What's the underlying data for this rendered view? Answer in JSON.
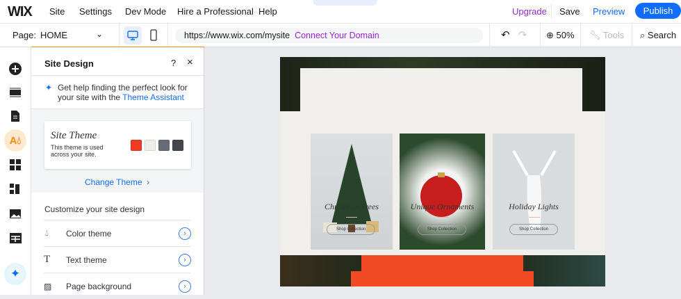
{
  "topbar": {
    "logo": "WIX",
    "menu": [
      "Site",
      "Settings",
      "Dev Mode",
      "Hire a Professional",
      "Help"
    ],
    "upgrade": "Upgrade",
    "save": "Save",
    "preview": "Preview",
    "publish": "Publish"
  },
  "toolbar": {
    "page_label": "Page:",
    "page_value": "HOME",
    "url": "https://www.wix.com/mysite",
    "connect_domain": "Connect Your Domain",
    "zoom": "50%",
    "tools": "Tools",
    "search": "Search"
  },
  "panel": {
    "title": "Site Design",
    "help": "?",
    "assistant_text": "Get help finding the perfect look for your site with the ",
    "assistant_link": "Theme Assistant",
    "theme_title": "Site Theme",
    "theme_desc": "This theme is used across your site.",
    "theme_colors": [
      "#f03c24",
      "#efeeeb",
      "#676b78",
      "#45474f"
    ],
    "change_theme": "Change Theme",
    "customize_heading": "Customize your site design",
    "rows": [
      "Color theme",
      "Text theme",
      "Page background"
    ]
  },
  "site": {
    "products": [
      {
        "title": "Christmas Trees",
        "button": "Shop Collection"
      },
      {
        "title": "Unique Ornaments",
        "button": "Shop Collection"
      },
      {
        "title": "Holiday Lights",
        "button": "Shop Collection"
      }
    ]
  },
  "colors": {
    "accent": "#116dff",
    "upgrade": "#9a27d5",
    "orange": "#f98b0a"
  }
}
